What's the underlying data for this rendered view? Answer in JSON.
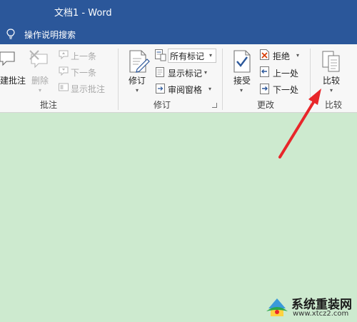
{
  "window": {
    "title": "文档1 - Word"
  },
  "tell_me": {
    "label": "操作说明搜索"
  },
  "ribbon": {
    "comments": {
      "group_label": "批注",
      "new_comment": "建批注",
      "delete": "删除",
      "previous": "上一条",
      "next": "下一条",
      "show_comments": "显示批注"
    },
    "tracking": {
      "group_label": "修订",
      "track_changes": "修订",
      "markup_select": "所有标记",
      "show_markup": "显示标记",
      "review_pane": "审阅窗格"
    },
    "changes": {
      "group_label": "更改",
      "accept": "接受",
      "reject": "拒绝",
      "previous": "上一处",
      "next": "下一处"
    },
    "compare": {
      "group_label": "比较",
      "compare": "比较"
    }
  },
  "annotation": {
    "color": "#e8262a"
  },
  "watermark": {
    "name": "系统重装网",
    "url": "www.xtcz2.com"
  }
}
